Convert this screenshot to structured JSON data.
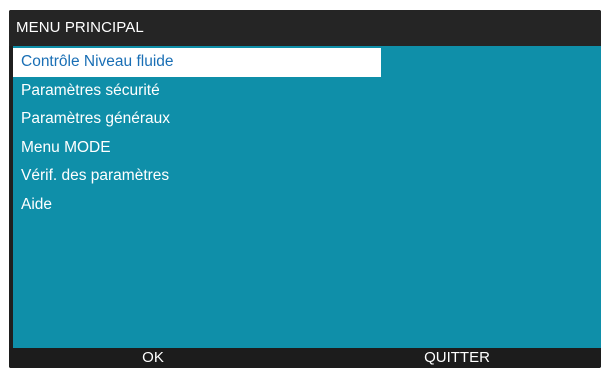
{
  "window": {
    "title": "MENU PRINCIPAL"
  },
  "menu": {
    "selected_index": 0,
    "items": [
      {
        "label": "Contrôle Niveau fluide"
      },
      {
        "label": "Paramètres sécurité"
      },
      {
        "label": "Paramètres généraux"
      },
      {
        "label": "Menu MODE"
      },
      {
        "label": "Vérif. des paramètres"
      },
      {
        "label": "Aide"
      }
    ]
  },
  "footer": {
    "ok_label": "OK",
    "quit_label": "QUITTER"
  },
  "colors": {
    "menu_background": "#0f8fa9",
    "selected_background": "#ffffff",
    "selected_text": "#1a6fb5",
    "bar_background": "#1f1f1f"
  }
}
